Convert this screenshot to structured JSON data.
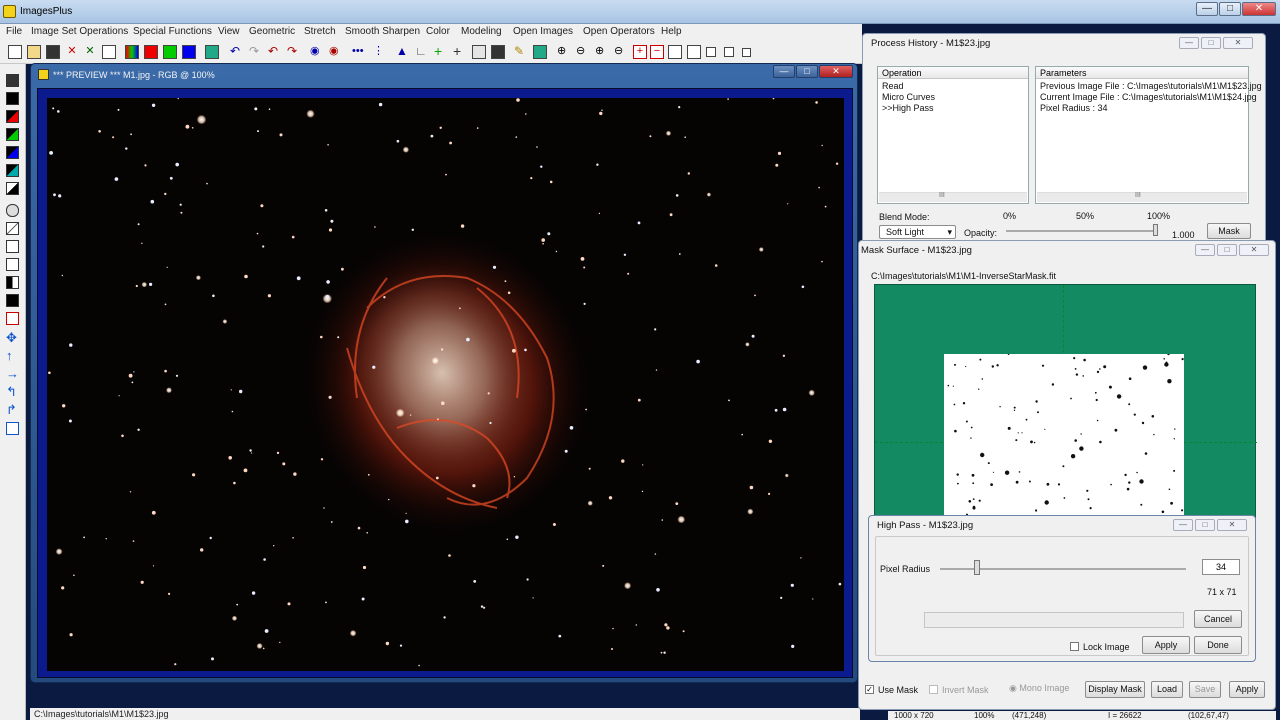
{
  "app": {
    "title": "ImagesPlus"
  },
  "menu": [
    "File",
    "Image Set Operations",
    "Special Functions",
    "View",
    "Geometric",
    "Stretch",
    "Smooth Sharpen",
    "Color",
    "Modeling",
    "Open Images",
    "Open Operators",
    "Help"
  ],
  "preview": {
    "title": "*** PREVIEW *** M1.jpg - RGB @ 100%",
    "nebula_description_icon": "crab-nebula-image"
  },
  "status": {
    "path": "C:\\Images\\tutorials\\M1\\M1$23.jpg"
  },
  "process_history": {
    "title": "Process History - M1$23.jpg",
    "col_operation": "Operation",
    "col_parameters": "Parameters",
    "operations": [
      "Read",
      "Micro Curves",
      ">>High Pass"
    ],
    "parameters": [
      "Previous Image File : C:\\Images\\tutorials\\M1\\M1$23.jpg",
      "Current Image File : C:\\Images\\tutorials\\M1\\M1$24.jpg",
      "Pixel Radius : 34"
    ],
    "scroll_grip": "III",
    "blend_mode_label": "Blend Mode:",
    "blend_mode_value": "Soft Light",
    "opacity_label": "Opacity:",
    "opacity_ticks": [
      "0%",
      "50%",
      "100%"
    ],
    "opacity_value": "1.000",
    "mask_button": "Mask"
  },
  "mask_surface": {
    "title": "Mask Surface - M1$23.jpg",
    "path": "C:\\Images\\tutorials\\M1\\M1-InverseStarMask.fit",
    "use_mask": "Use Mask",
    "invert_mask": "Invert Mask",
    "mono_image": "Mono Image",
    "display_mask": "Display Mask",
    "load": "Load",
    "save": "Save",
    "apply": "Apply",
    "bg_color": "#148a63"
  },
  "high_pass": {
    "title": "High Pass - M1$23.jpg",
    "pixel_radius_label": "Pixel Radius",
    "pixel_radius_value": "34",
    "kernel_size": "71 x 71",
    "cancel": "Cancel",
    "lock_image": "Lock Image",
    "apply": "Apply",
    "done": "Done"
  },
  "bottom_status": {
    "dims": "1000 x 720",
    "zoom": "100%",
    "coords": "(471,248)",
    "intensity": "I = 26622",
    "rgb": "(102,67,47)"
  },
  "window_controls": {
    "minimize": "—",
    "maximize": "□",
    "close": "✕"
  }
}
